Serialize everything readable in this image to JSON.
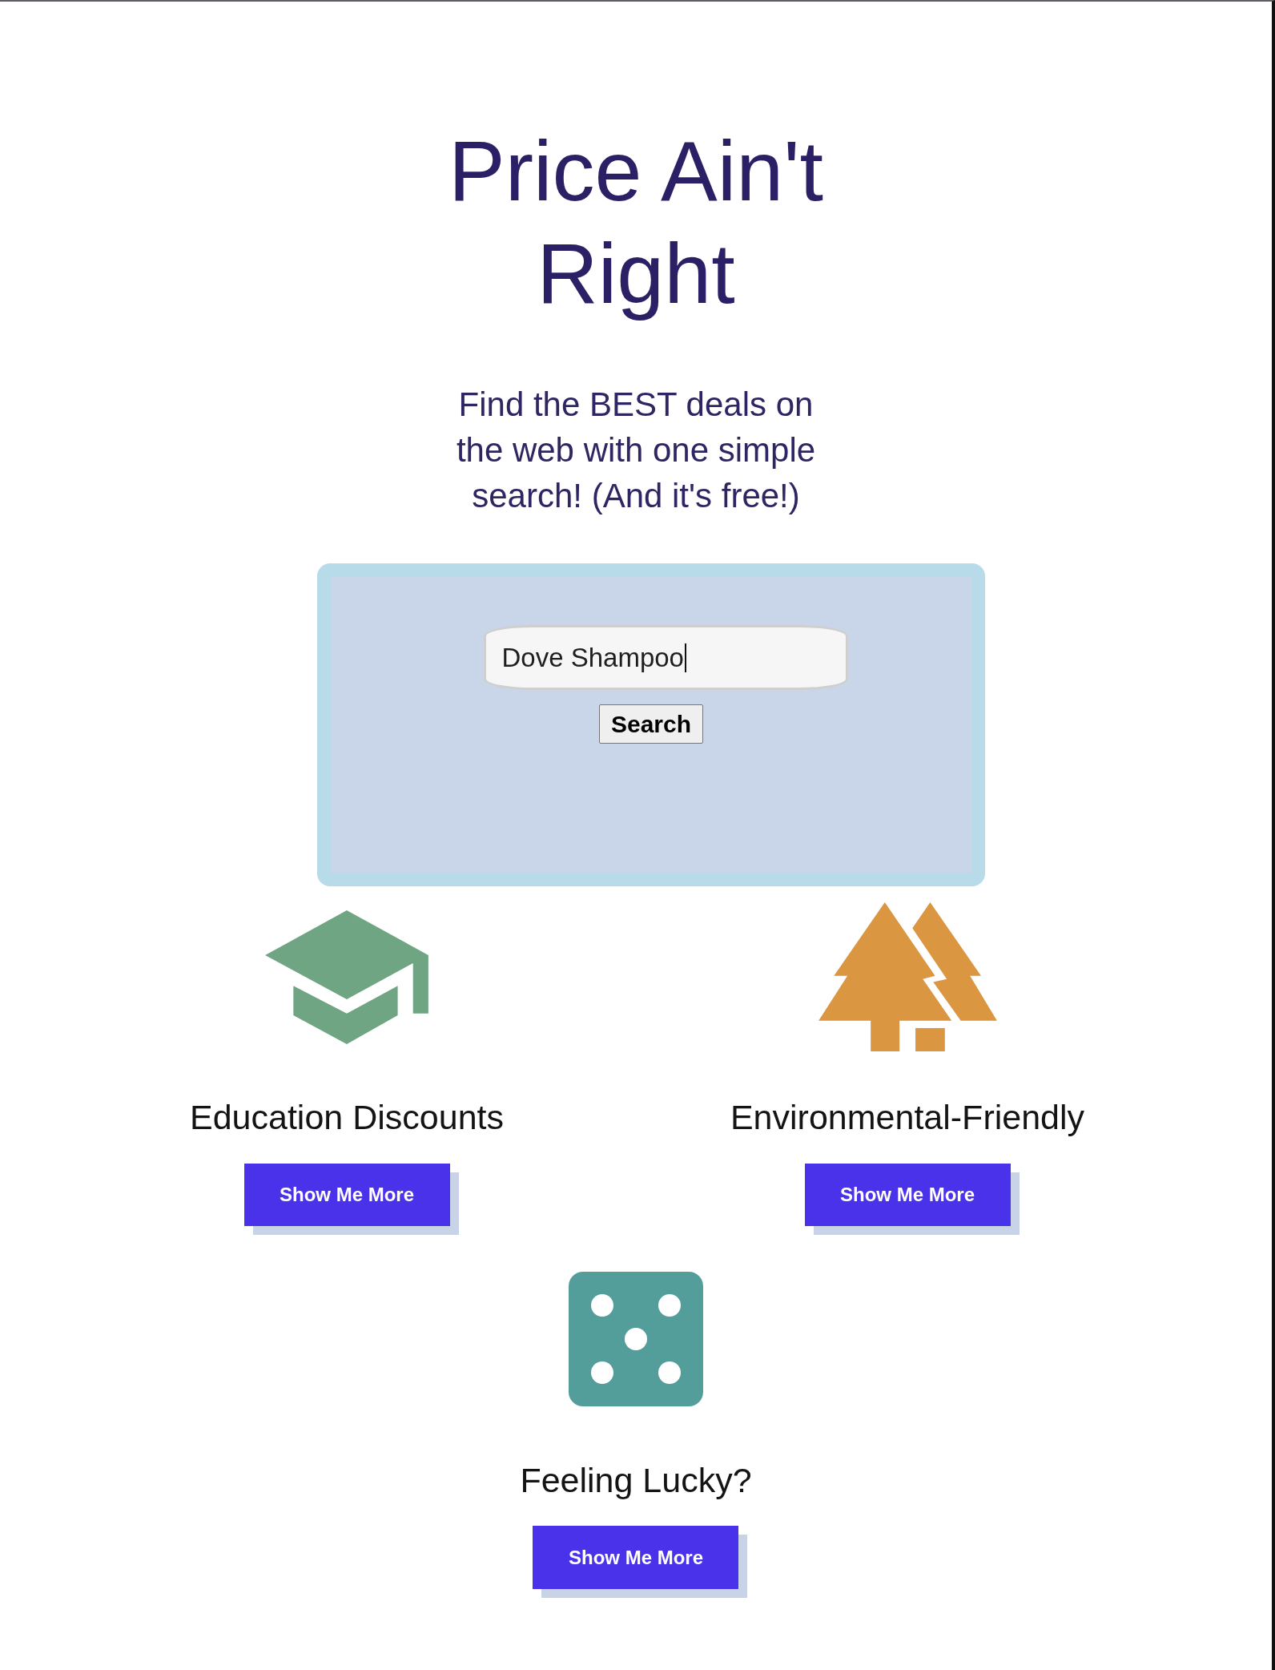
{
  "header": {
    "title": "Price Ain't Right",
    "tagline": "Find the BEST deals on the web with one simple search! (And it's free!)"
  },
  "search": {
    "value": "Dove Shampoo",
    "focused": true,
    "button": "Search"
  },
  "features": [
    {
      "kind": "education",
      "title": "Education Discounts",
      "button": "Show Me More"
    },
    {
      "kind": "environment",
      "title": "Environmental-Friendly",
      "button": "Show Me More"
    },
    {
      "kind": "lucky",
      "title": "Feeling Lucky?",
      "button": "Show Me More"
    }
  ]
}
